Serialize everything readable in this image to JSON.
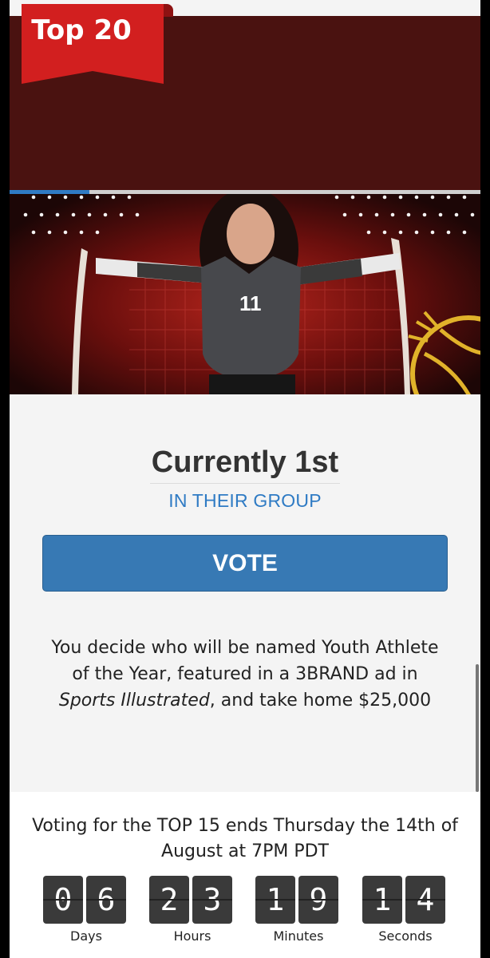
{
  "badge": {
    "label": "Top 20"
  },
  "status": {
    "rank": "Currently 1st",
    "group": "IN THEIR GROUP"
  },
  "vote": {
    "label": "VOTE"
  },
  "description": {
    "part1": "You decide who will be named Youth Athlete of the Year, featured in a 3BRAND ad in ",
    "italic": "Sports Illustrated",
    "part2": ", and take home $25,000"
  },
  "deadline": {
    "text": "Voting for the TOP 15 ends Thursday the 14th of August at 7PM PDT"
  },
  "countdown": [
    {
      "label": "Days",
      "d1": "0",
      "d2": "6"
    },
    {
      "label": "Hours",
      "d1": "2",
      "d2": "3"
    },
    {
      "label": "Minutes",
      "d1": "1",
      "d2": "9"
    },
    {
      "label": "Seconds",
      "d1": "1",
      "d2": "4"
    }
  ],
  "photo": {
    "jersey_number": "11",
    "progress_fraction": 0.17
  },
  "colors": {
    "accent": "#3779b4",
    "badge": "#d21f1f",
    "hero_bg": "#4a1210"
  }
}
